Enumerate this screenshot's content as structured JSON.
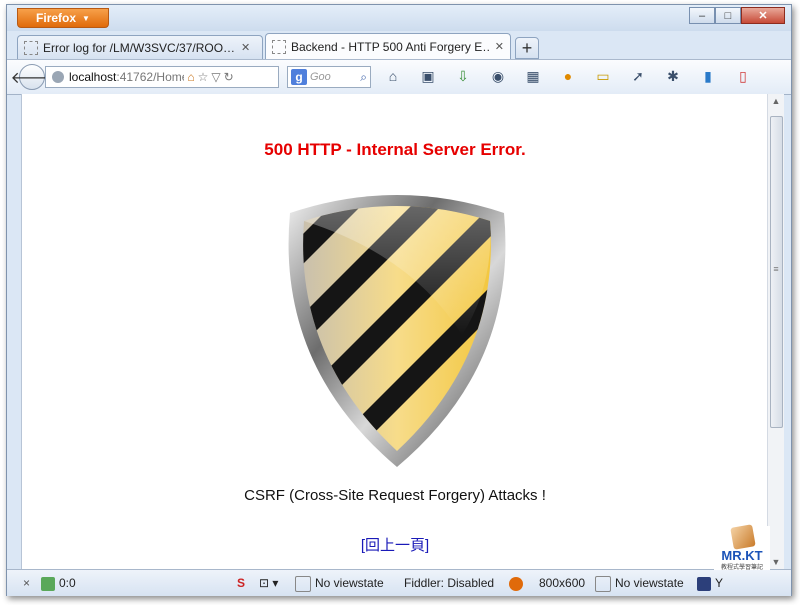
{
  "app": {
    "menu_button": "Firefox",
    "window_buttons": [
      "minimize",
      "maximize",
      "close"
    ]
  },
  "tabs": [
    {
      "title": "Error log for /LM/W3SVC/37/ROO…",
      "active": false
    },
    {
      "title": "Backend - HTTP 500 Anti Forgery E…",
      "active": true
    }
  ],
  "nav": {
    "url_host": "localhost",
    "url_path": ":41762/Home",
    "search_placeholder": "Goo",
    "search_engine": "g",
    "toolbar_icons": [
      "home-icon",
      "bookmarks-icon",
      "download-icon",
      "addon-icon",
      "grid-icon",
      "firebug-icon",
      "note-icon",
      "pointer-icon",
      "bug-icon",
      "database-icon",
      "battery-icon"
    ]
  },
  "page": {
    "error_heading": "500 HTTP - Internal Server Error.",
    "message": "CSRF (Cross-Site Request Forgery) Attacks !",
    "back_link": "[回上一頁]"
  },
  "status": {
    "close": "×",
    "counter": "0:0",
    "viewstate1": "No viewstate",
    "fiddler": "Fiddler: Disabled",
    "resolution": "800x600",
    "viewstate2": "No viewstate",
    "trailing": "Y"
  },
  "watermark": {
    "name": "MR.KT",
    "subtitle": "教程式學習筆記"
  },
  "colors": {
    "error": "#e60000",
    "link": "#1a1ab8",
    "firefox_button": "#e06a0a"
  }
}
